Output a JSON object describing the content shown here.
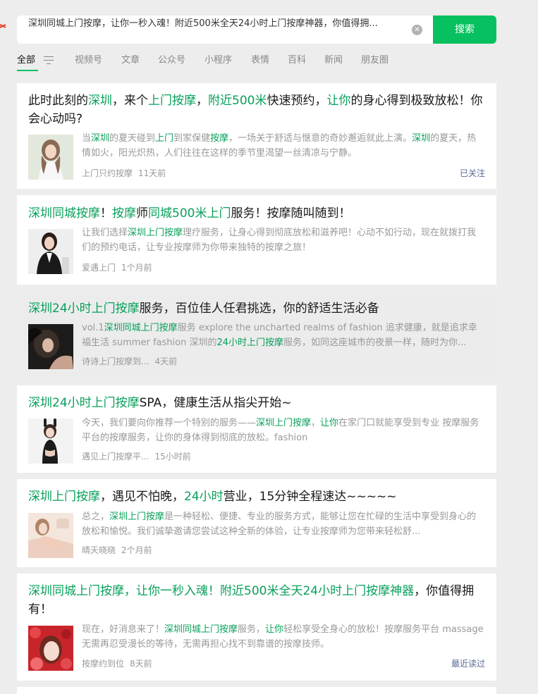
{
  "search": {
    "query": "深圳同城上门按摩，让你一秒入魂！附近500米全天24小时上门按摩神器，你值得拥...",
    "button_label": "搜索"
  },
  "tabs": [
    "全部",
    "视频号",
    "文章",
    "公众号",
    "小程序",
    "表情",
    "百科",
    "新闻",
    "朋友圈"
  ],
  "accent_color": "#07c160",
  "highlight_color": "#07a05a",
  "results": [
    {
      "title": [
        [
          "此时此刻的",
          false
        ],
        [
          "深圳",
          true
        ],
        [
          "，来个",
          false
        ],
        [
          "上门按摩",
          true
        ],
        [
          "，",
          false
        ],
        [
          "附近500米",
          true
        ],
        [
          "快速预约，",
          false
        ],
        [
          "让你",
          true
        ],
        [
          "的身心得到极致放松！你会心动吗?",
          false
        ]
      ],
      "snippet": [
        [
          "当",
          false
        ],
        [
          "深圳",
          true
        ],
        [
          "的夏天碰到",
          false
        ],
        [
          "上门",
          true
        ],
        [
          "到家保健",
          false
        ],
        [
          "按摩",
          true
        ],
        [
          "，一场关于舒适与惬意的奇妙邂逅就此上演。",
          false
        ],
        [
          "深圳",
          true
        ],
        [
          "的夏天，热情如火，阳光炽热，人们往往在这样的季节里渴望一丝清凉与宁静。",
          false
        ]
      ],
      "source": "上门只约按摩",
      "time": "11天前",
      "tag": "已关注",
      "thumb": "woman-white-blouse"
    },
    {
      "title": [
        [
          "深圳同城按摩",
          true
        ],
        [
          "！",
          false
        ],
        [
          "按摩",
          true
        ],
        [
          "师",
          false
        ],
        [
          "同城500米上门",
          true
        ],
        [
          "服务！按摩随叫随到！",
          false
        ]
      ],
      "snippet": [
        [
          "让我们选择",
          false
        ],
        [
          "深圳上门按摩",
          true
        ],
        [
          "理疗服务，让身心得到彻底放松和滋养吧！心动不如行动，现在就拨打我们的预约电话，让专业按摩师为你带来独特的按摩之旅！",
          false
        ]
      ],
      "source": "爱遇上门",
      "time": "1个月前",
      "tag": "",
      "thumb": "woman-black-suit"
    },
    {
      "title": [
        [
          "深圳24小时上门按摩",
          true
        ],
        [
          "服务，百位佳人任君挑选，你的舒适生活必备",
          false
        ]
      ],
      "snippet": [
        [
          "vol.1",
          false
        ],
        [
          "深圳同城上门按摩",
          true
        ],
        [
          "服务 explore the uncharted realms of fashion 追求健康，就是追求幸福生活 summer fashion 深圳的",
          false
        ],
        [
          "24小时上门按摩",
          true
        ],
        [
          "服务，如同这座城市的夜景一样，随时为你...",
          false
        ]
      ],
      "source": "诗诗上门按摩到...",
      "time": "4天前",
      "tag": "",
      "thumb": "dark-portrait"
    },
    {
      "title": [
        [
          "深圳24小时上门按摩",
          true
        ],
        [
          "SPA，健康生活从指尖开始~",
          false
        ]
      ],
      "snippet": [
        [
          "今天，我们要向你推荐一个特别的服务——",
          false
        ],
        [
          "深圳上门按摩",
          true
        ],
        [
          "，",
          false
        ],
        [
          "让你",
          true
        ],
        [
          "在家门口就能享受到专业 按摩服务平台的按摩服务，让你的身体得到彻底的放松。fashion",
          false
        ]
      ],
      "source": "遇见上门按摩平...",
      "time": "15小时前",
      "tag": "",
      "thumb": "bunny-costume"
    },
    {
      "title": [
        [
          "深圳上门按摩",
          true
        ],
        [
          "，遇见不怕晚，",
          false
        ],
        [
          "24小时",
          true
        ],
        [
          "营业，15分钟全程速达~~~~~",
          false
        ]
      ],
      "snippet": [
        [
          "总之，",
          false
        ],
        [
          "深圳上门按摩",
          true
        ],
        [
          "是一种轻松、便捷、专业的服务方式，能够让您在忙碌的生活中享受到身心的放松和愉悦。我们诚挚邀请您尝试这种全新的体验，让专业按摩师为您带来轻松舒...",
          false
        ]
      ],
      "source": "晴天晓晓",
      "time": "2个月前",
      "tag": "",
      "thumb": "pink-bed"
    },
    {
      "title": [
        [
          "深圳同城上门按摩，让你一秒入魂！附近500米全天24小时上门按摩神器",
          true
        ],
        [
          "，你值得拥有！",
          false
        ]
      ],
      "snippet": [
        [
          "现在，好消息来了！",
          false
        ],
        [
          "深圳同城上门按摩",
          true
        ],
        [
          "服务，",
          false
        ],
        [
          "让你",
          true
        ],
        [
          "轻松享受全身心的放松！按摩服务平台 massage 无需再忍受漫长的等待，无需再担心找不到靠谱的按摩技师。",
          false
        ]
      ],
      "source": "按摩约到位",
      "time": "8天前",
      "tag": "最近读过",
      "thumb": "red-flowers"
    }
  ]
}
